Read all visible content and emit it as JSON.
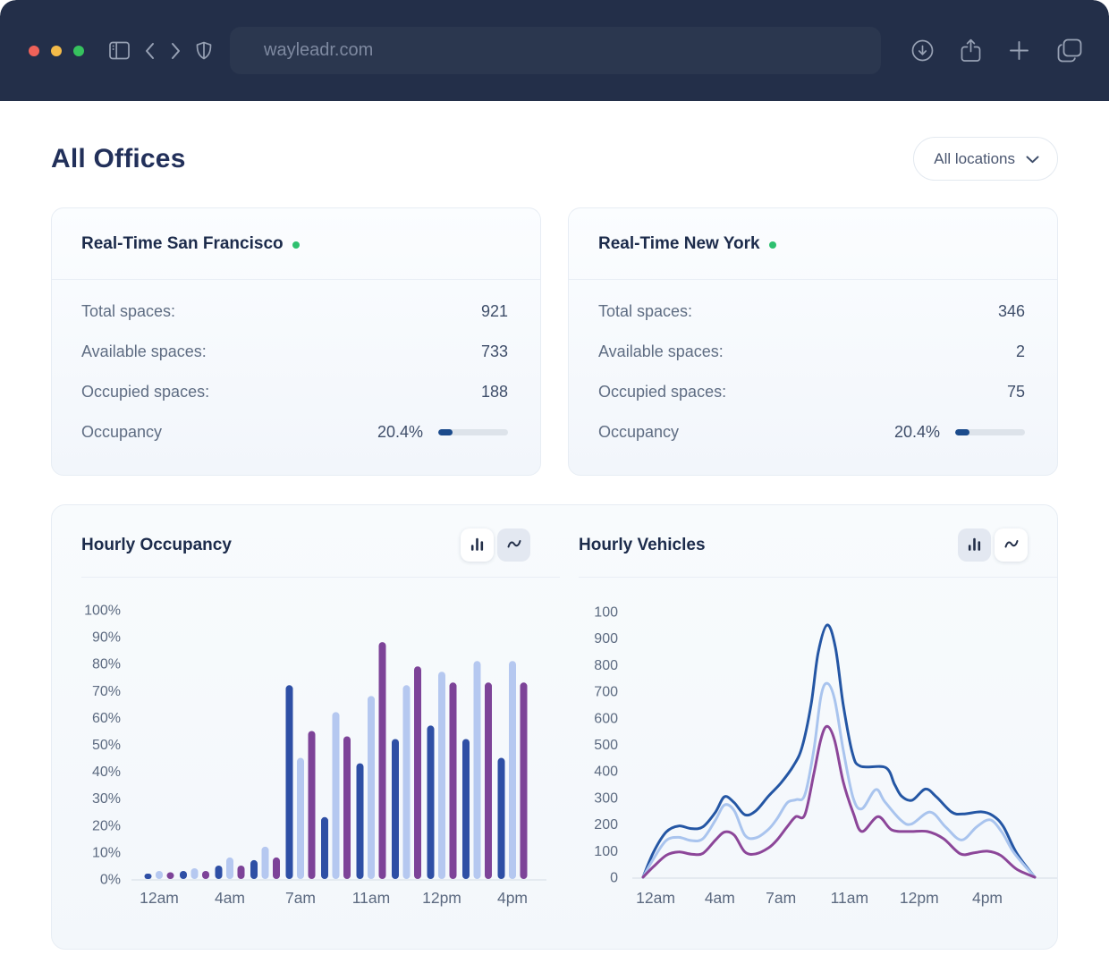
{
  "browser": {
    "url": "wayleadr.com",
    "traffic_light_colors": [
      "#ef6259",
      "#f3bb49",
      "#36c25e"
    ],
    "icons": [
      "sidebar-icon",
      "back-icon",
      "forward-icon",
      "shield-icon",
      "download-icon",
      "share-icon",
      "new-tab-icon",
      "tabs-icon"
    ]
  },
  "page": {
    "title": "All Offices",
    "location_filter": {
      "label": "All locations",
      "icon": "chevron-down-icon"
    }
  },
  "cards": [
    {
      "title": "Real-Time San Francisco",
      "status_color": "#2ec06f",
      "rows": [
        {
          "label": "Total spaces:",
          "value": "921"
        },
        {
          "label": "Available spaces:",
          "value": "733"
        },
        {
          "label": "Occupied spaces:",
          "value": "188"
        }
      ],
      "occupancy": {
        "label": "Occupancy",
        "value": "20.4%",
        "percent": 20.4
      }
    },
    {
      "title": "Real-Time New York",
      "status_color": "#2ec06f",
      "rows": [
        {
          "label": "Total spaces:",
          "value": "346"
        },
        {
          "label": "Available spaces:",
          "value": "2"
        },
        {
          "label": "Occupied spaces:",
          "value": "75"
        }
      ],
      "occupancy": {
        "label": "Occupancy",
        "value": "20.4%",
        "percent": 20.4
      }
    }
  ],
  "chart_data": [
    {
      "type": "bar",
      "title": "Hourly Occupancy",
      "ylim": [
        0,
        100
      ],
      "y_ticks": [
        0,
        10,
        20,
        30,
        40,
        50,
        60,
        70,
        80,
        90,
        100
      ],
      "y_tick_suffix": "%",
      "x_tick_labels": [
        "12am",
        "4am",
        "7am",
        "11am",
        "12pm",
        "4pm"
      ],
      "x_tick_group_indices": [
        0,
        2,
        4,
        6,
        8,
        10
      ],
      "series": [
        {
          "name": "dark-blue",
          "color": "#2e4fa5",
          "values": [
            2,
            3,
            5,
            7,
            72,
            23,
            43,
            52,
            57,
            52,
            45
          ]
        },
        {
          "name": "light-blue",
          "color": "#b5c8f0",
          "values": [
            3,
            4,
            8,
            12,
            45,
            62,
            68,
            72,
            77,
            81,
            81
          ]
        },
        {
          "name": "purple",
          "color": "#7d4398",
          "values": [
            2.5,
            3,
            5,
            8,
            55,
            53,
            88,
            79,
            73,
            73,
            73
          ]
        }
      ]
    },
    {
      "type": "line",
      "title": "Hourly Vehicles",
      "ylim": [
        0,
        1000
      ],
      "y_tick_labels": [
        "0",
        "100",
        "200",
        "300",
        "400",
        "500",
        "600",
        "700",
        "800",
        "900",
        "100"
      ],
      "x_tick_labels": [
        "12am",
        "4am",
        "7am",
        "11am",
        "12pm",
        "4pm"
      ],
      "x_tick_positions": [
        0.032,
        0.196,
        0.352,
        0.527,
        0.705,
        0.879
      ],
      "series": [
        {
          "name": "dark-blue",
          "color": "#2456a4",
          "points": [
            [
              0,
              0
            ],
            [
              0.027,
              95
            ],
            [
              0.059,
              170
            ],
            [
              0.091,
              193
            ],
            [
              0.123,
              183
            ],
            [
              0.153,
              190
            ],
            [
              0.185,
              245
            ],
            [
              0.208,
              303
            ],
            [
              0.233,
              280
            ],
            [
              0.26,
              235
            ],
            [
              0.288,
              250
            ],
            [
              0.32,
              305
            ],
            [
              0.352,
              355
            ],
            [
              0.384,
              420
            ],
            [
              0.406,
              490
            ],
            [
              0.429,
              650
            ],
            [
              0.447,
              845
            ],
            [
              0.47,
              950
            ],
            [
              0.491,
              865
            ],
            [
              0.511,
              650
            ],
            [
              0.534,
              470
            ],
            [
              0.555,
              418
            ],
            [
              0.619,
              413
            ],
            [
              0.642,
              350
            ],
            [
              0.66,
              305
            ],
            [
              0.687,
              290
            ],
            [
              0.721,
              332
            ],
            [
              0.749,
              302
            ],
            [
              0.788,
              245
            ],
            [
              0.817,
              238
            ],
            [
              0.863,
              246
            ],
            [
              0.893,
              232
            ],
            [
              0.92,
              190
            ],
            [
              0.954,
              90
            ],
            [
              1,
              0
            ]
          ]
        },
        {
          "name": "light-blue",
          "color": "#a9c4ee",
          "points": [
            [
              0,
              0
            ],
            [
              0.027,
              70
            ],
            [
              0.059,
              138
            ],
            [
              0.091,
              150
            ],
            [
              0.123,
              138
            ],
            [
              0.153,
              145
            ],
            [
              0.185,
              215
            ],
            [
              0.208,
              272
            ],
            [
              0.233,
              250
            ],
            [
              0.26,
              158
            ],
            [
              0.288,
              148
            ],
            [
              0.32,
              180
            ],
            [
              0.343,
              222
            ],
            [
              0.368,
              280
            ],
            [
              0.391,
              292
            ],
            [
              0.413,
              310
            ],
            [
              0.436,
              480
            ],
            [
              0.454,
              680
            ],
            [
              0.47,
              730
            ],
            [
              0.489,
              670
            ],
            [
              0.511,
              480
            ],
            [
              0.536,
              300
            ],
            [
              0.559,
              258
            ],
            [
              0.594,
              330
            ],
            [
              0.617,
              285
            ],
            [
              0.658,
              215
            ],
            [
              0.685,
              200
            ],
            [
              0.733,
              245
            ],
            [
              0.772,
              190
            ],
            [
              0.813,
              140
            ],
            [
              0.852,
              190
            ],
            [
              0.886,
              216
            ],
            [
              0.916,
              170
            ],
            [
              0.948,
              90
            ],
            [
              1,
              0
            ]
          ]
        },
        {
          "name": "purple",
          "color": "#8c4699",
          "points": [
            [
              0,
              0
            ],
            [
              0.027,
              40
            ],
            [
              0.059,
              82
            ],
            [
              0.091,
              95
            ],
            [
              0.123,
              87
            ],
            [
              0.153,
              90
            ],
            [
              0.185,
              140
            ],
            [
              0.208,
              170
            ],
            [
              0.233,
              158
            ],
            [
              0.26,
              95
            ],
            [
              0.288,
              88
            ],
            [
              0.32,
              110
            ],
            [
              0.342,
              140
            ],
            [
              0.368,
              190
            ],
            [
              0.39,
              228
            ],
            [
              0.413,
              235
            ],
            [
              0.436,
              390
            ],
            [
              0.454,
              520
            ],
            [
              0.47,
              568
            ],
            [
              0.489,
              515
            ],
            [
              0.511,
              360
            ],
            [
              0.537,
              240
            ],
            [
              0.559,
              172
            ],
            [
              0.6,
              228
            ],
            [
              0.635,
              178
            ],
            [
              0.68,
              172
            ],
            [
              0.726,
              172
            ],
            [
              0.767,
              145
            ],
            [
              0.81,
              88
            ],
            [
              0.845,
              92
            ],
            [
              0.879,
              98
            ],
            [
              0.913,
              82
            ],
            [
              0.954,
              30
            ],
            [
              1,
              0
            ]
          ]
        }
      ]
    }
  ],
  "colors": {
    "topbar_bg": "#232f49",
    "axis_text": "#5c6a80",
    "axis_line": "#dfe5ec",
    "progress_fill": "#1b4b8c",
    "progress_track": "#dde3ea"
  }
}
